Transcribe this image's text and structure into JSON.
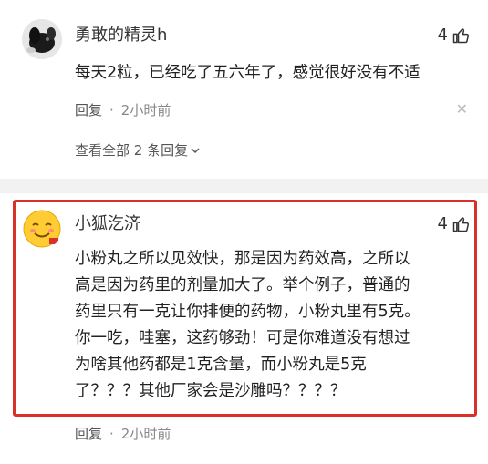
{
  "comment1": {
    "username": "勇敢的精灵h",
    "likes": "4",
    "text": "每天2粒，已经吃了五六年了，感觉很好没有不适",
    "reply_label": "回复",
    "separator": "·",
    "time": "2小时前",
    "view_all": "查看全部 2 条回复"
  },
  "comment2": {
    "username": "小狐汔济",
    "likes": "4",
    "lines": [
      "小粉丸之所以见效快，那是因为药效高，之所以",
      "高是因为药里的剂量加大了。举个例子，普通的",
      "药里只有一克让你排便的药物，小粉丸里有5克。",
      "你一吃，哇塞，这药够劲！可是你难道没有想过",
      "为啥其他药都是1克含量，而小粉丸是5克",
      "了？？？其他厂家会是沙雕吗？？？？"
    ],
    "reply_label": "回复",
    "separator": "·",
    "time": "2小时前"
  },
  "colors": {
    "highlight_border": "#d9302a",
    "meta_text": "#888888",
    "body_text": "#222222"
  },
  "icons": [
    "avatar-dog-icon",
    "thumbs-up-icon",
    "close-icon",
    "chevron-down-icon",
    "avatar-emoji-icon"
  ]
}
